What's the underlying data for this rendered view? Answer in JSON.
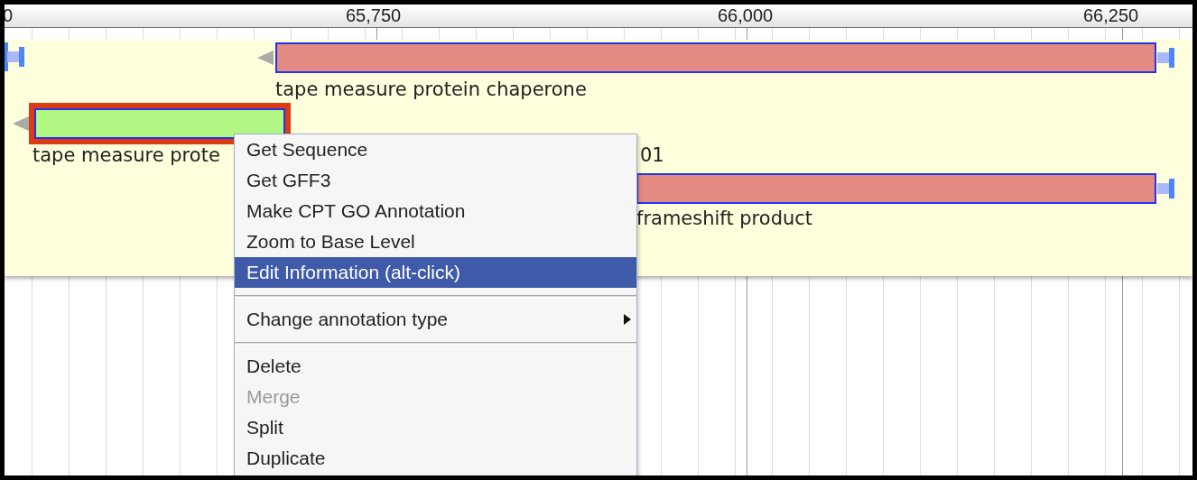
{
  "ruler": {
    "ticks": [
      {
        "label": "0"
      },
      {
        "label": "65,750"
      },
      {
        "label": "66,000"
      },
      {
        "label": "66,250"
      }
    ]
  },
  "track": {
    "features": [
      {
        "kind": "bar",
        "color": "#e38a83",
        "selected": false,
        "label": "tape measure protein chaperone"
      },
      {
        "kind": "bar",
        "color": "#b2f784",
        "selected": true,
        "label": "tape measure prote"
      },
      {
        "kind": "bar",
        "color": "#e38a83",
        "selected": false,
        "label": "frameshift product"
      }
    ],
    "label_fragments": [
      "01"
    ]
  },
  "context_menu": {
    "items": [
      {
        "kind": "item",
        "label": "Get Sequence",
        "selected": false,
        "disabled": false
      },
      {
        "kind": "item",
        "label": "Get GFF3",
        "selected": false,
        "disabled": false
      },
      {
        "kind": "item",
        "label": "Make CPT GO Annotation",
        "selected": false,
        "disabled": false
      },
      {
        "kind": "item",
        "label": "Zoom to Base Level",
        "selected": false,
        "disabled": false
      },
      {
        "kind": "item",
        "label": "Edit Information (alt-click)",
        "selected": true,
        "disabled": false
      },
      {
        "kind": "separator"
      },
      {
        "kind": "submenu",
        "label": "Change annotation type",
        "selected": false,
        "disabled": false
      },
      {
        "kind": "separator"
      },
      {
        "kind": "item",
        "label": "Delete",
        "selected": false,
        "disabled": false
      },
      {
        "kind": "item",
        "label": "Merge",
        "selected": false,
        "disabled": true
      },
      {
        "kind": "item",
        "label": "Split",
        "selected": false,
        "disabled": false
      },
      {
        "kind": "item",
        "label": "Duplicate",
        "selected": false,
        "disabled": false
      }
    ]
  }
}
